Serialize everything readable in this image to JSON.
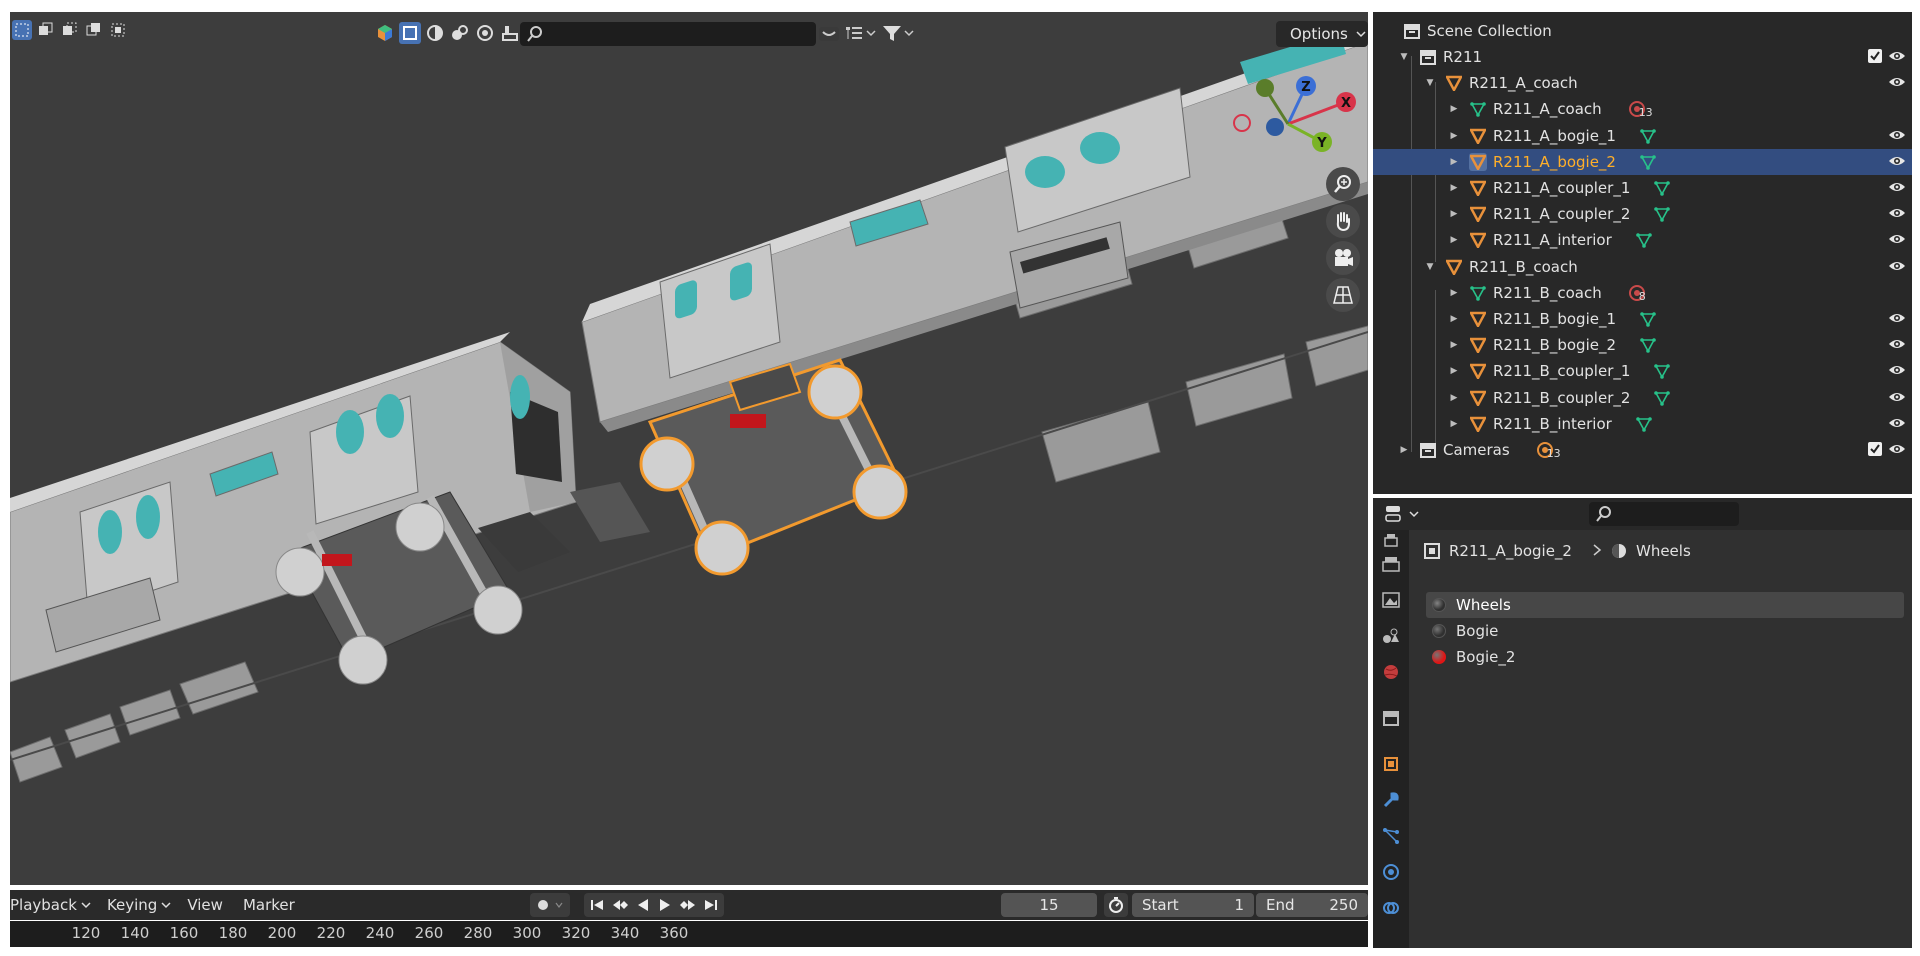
{
  "viewport": {
    "options_label": "Options",
    "gizmo": {
      "z": "Z",
      "x": "X",
      "y": "Y"
    }
  },
  "timeline": {
    "menus": [
      "Playback",
      "Keying",
      "View",
      "Marker"
    ],
    "current_frame": "15",
    "start_label": "Start",
    "start_value": "1",
    "end_label": "End",
    "end_value": "250",
    "ruler": [
      "120",
      "140",
      "160",
      "180",
      "200",
      "220",
      "240",
      "260",
      "280",
      "300",
      "320",
      "340",
      "360"
    ]
  },
  "outliner": {
    "title": "Scene Collection",
    "rows": [
      {
        "label": "R211",
        "type": "collection",
        "indent": 1,
        "expanded": true,
        "checkbox": true,
        "eye": true
      },
      {
        "label": "R211_A_coach",
        "type": "empty",
        "indent": 2,
        "expanded": true,
        "eye": true
      },
      {
        "label": "R211_A_coach",
        "type": "mesh",
        "indent": 3,
        "badge": "13",
        "eye": false
      },
      {
        "label": "R211_A_bogie_1",
        "type": "empty",
        "indent": 3,
        "mesh_child": true,
        "eye": true
      },
      {
        "label": "R211_A_bogie_2",
        "type": "empty",
        "indent": 3,
        "mesh_child": true,
        "eye": true,
        "selected": true
      },
      {
        "label": "R211_A_coupler_1",
        "type": "empty",
        "indent": 3,
        "mesh_child": true,
        "eye": true
      },
      {
        "label": "R211_A_coupler_2",
        "type": "empty",
        "indent": 3,
        "mesh_child": true,
        "eye": true
      },
      {
        "label": "R211_A_interior",
        "type": "empty",
        "indent": 3,
        "mesh_child": true,
        "eye": true
      },
      {
        "label": "R211_B_coach",
        "type": "empty",
        "indent": 2,
        "expanded": true,
        "eye": true
      },
      {
        "label": "R211_B_coach",
        "type": "mesh",
        "indent": 3,
        "badge": "8",
        "eye": false
      },
      {
        "label": "R211_B_bogie_1",
        "type": "empty",
        "indent": 3,
        "mesh_child": true,
        "eye": true
      },
      {
        "label": "R211_B_bogie_2",
        "type": "empty",
        "indent": 3,
        "mesh_child": true,
        "eye": true
      },
      {
        "label": "R211_B_coupler_1",
        "type": "empty",
        "indent": 3,
        "mesh_child": true,
        "eye": true
      },
      {
        "label": "R211_B_coupler_2",
        "type": "empty",
        "indent": 3,
        "mesh_child": true,
        "eye": true
      },
      {
        "label": "R211_B_interior",
        "type": "empty",
        "indent": 3,
        "mesh_child": true,
        "eye": true
      },
      {
        "label": "Cameras",
        "type": "collection",
        "indent": 1,
        "expanded": false,
        "badge": "13",
        "checkbox": true,
        "eye": true
      }
    ]
  },
  "properties": {
    "breadcrumb_object": "R211_A_bogie_2",
    "breadcrumb_material": "Wheels",
    "materials": [
      {
        "name": "Wheels",
        "color": "#303030",
        "active": true
      },
      {
        "name": "Bogie",
        "color": "#303030",
        "active": false
      },
      {
        "name": "Bogie_2",
        "color": "#e01515",
        "active": false
      }
    ]
  },
  "colors": {
    "accent": "#4772b3",
    "selected_row": "#334d80",
    "selection_outline": "#f29a2e",
    "empty_icon": "#e8913b",
    "mesh_icon": "#27c28a"
  }
}
